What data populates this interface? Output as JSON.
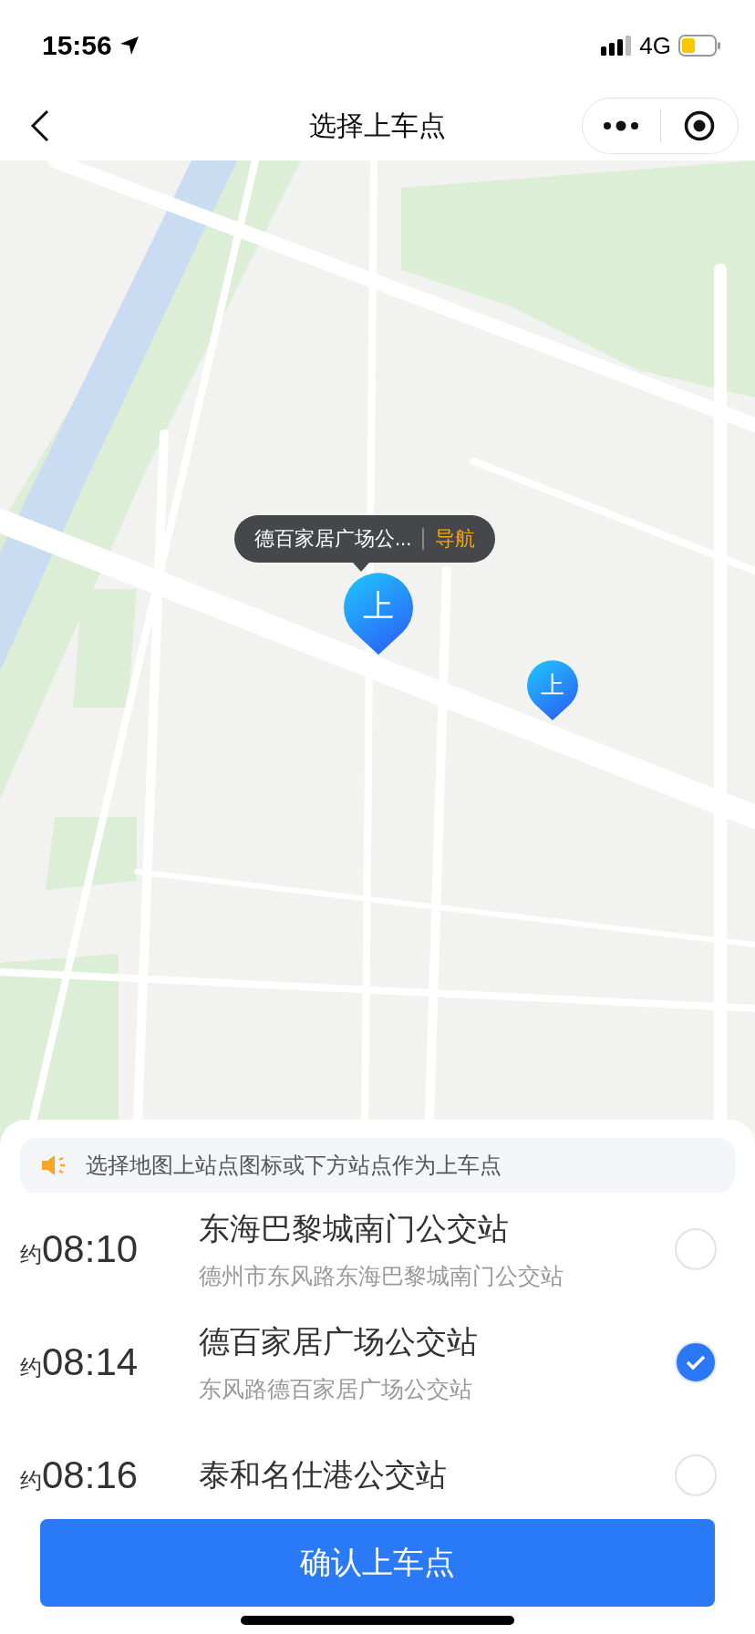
{
  "status_bar": {
    "time": "15:56",
    "network": "4G"
  },
  "nav": {
    "title": "选择上车点"
  },
  "map": {
    "callout": {
      "text": "德百家居广场公...",
      "action": "导航"
    },
    "pins": [
      {
        "label": "上",
        "selected": true
      },
      {
        "label": "上",
        "selected": false
      }
    ]
  },
  "notice": "选择地图上站点图标或下方站点作为上车点",
  "stations": [
    {
      "prefix": "约",
      "time": "08:10",
      "name": "东海巴黎城南门公交站",
      "address": "德州市东风路东海巴黎城南门公交站",
      "selected": false
    },
    {
      "prefix": "约",
      "time": "08:14",
      "name": "德百家居广场公交站",
      "address": "东风路德百家居广场公交站",
      "selected": true
    },
    {
      "prefix": "约",
      "time": "08:16",
      "name": "泰和名仕港公交站",
      "selected": false
    }
  ],
  "confirm_button": "确认上车点"
}
